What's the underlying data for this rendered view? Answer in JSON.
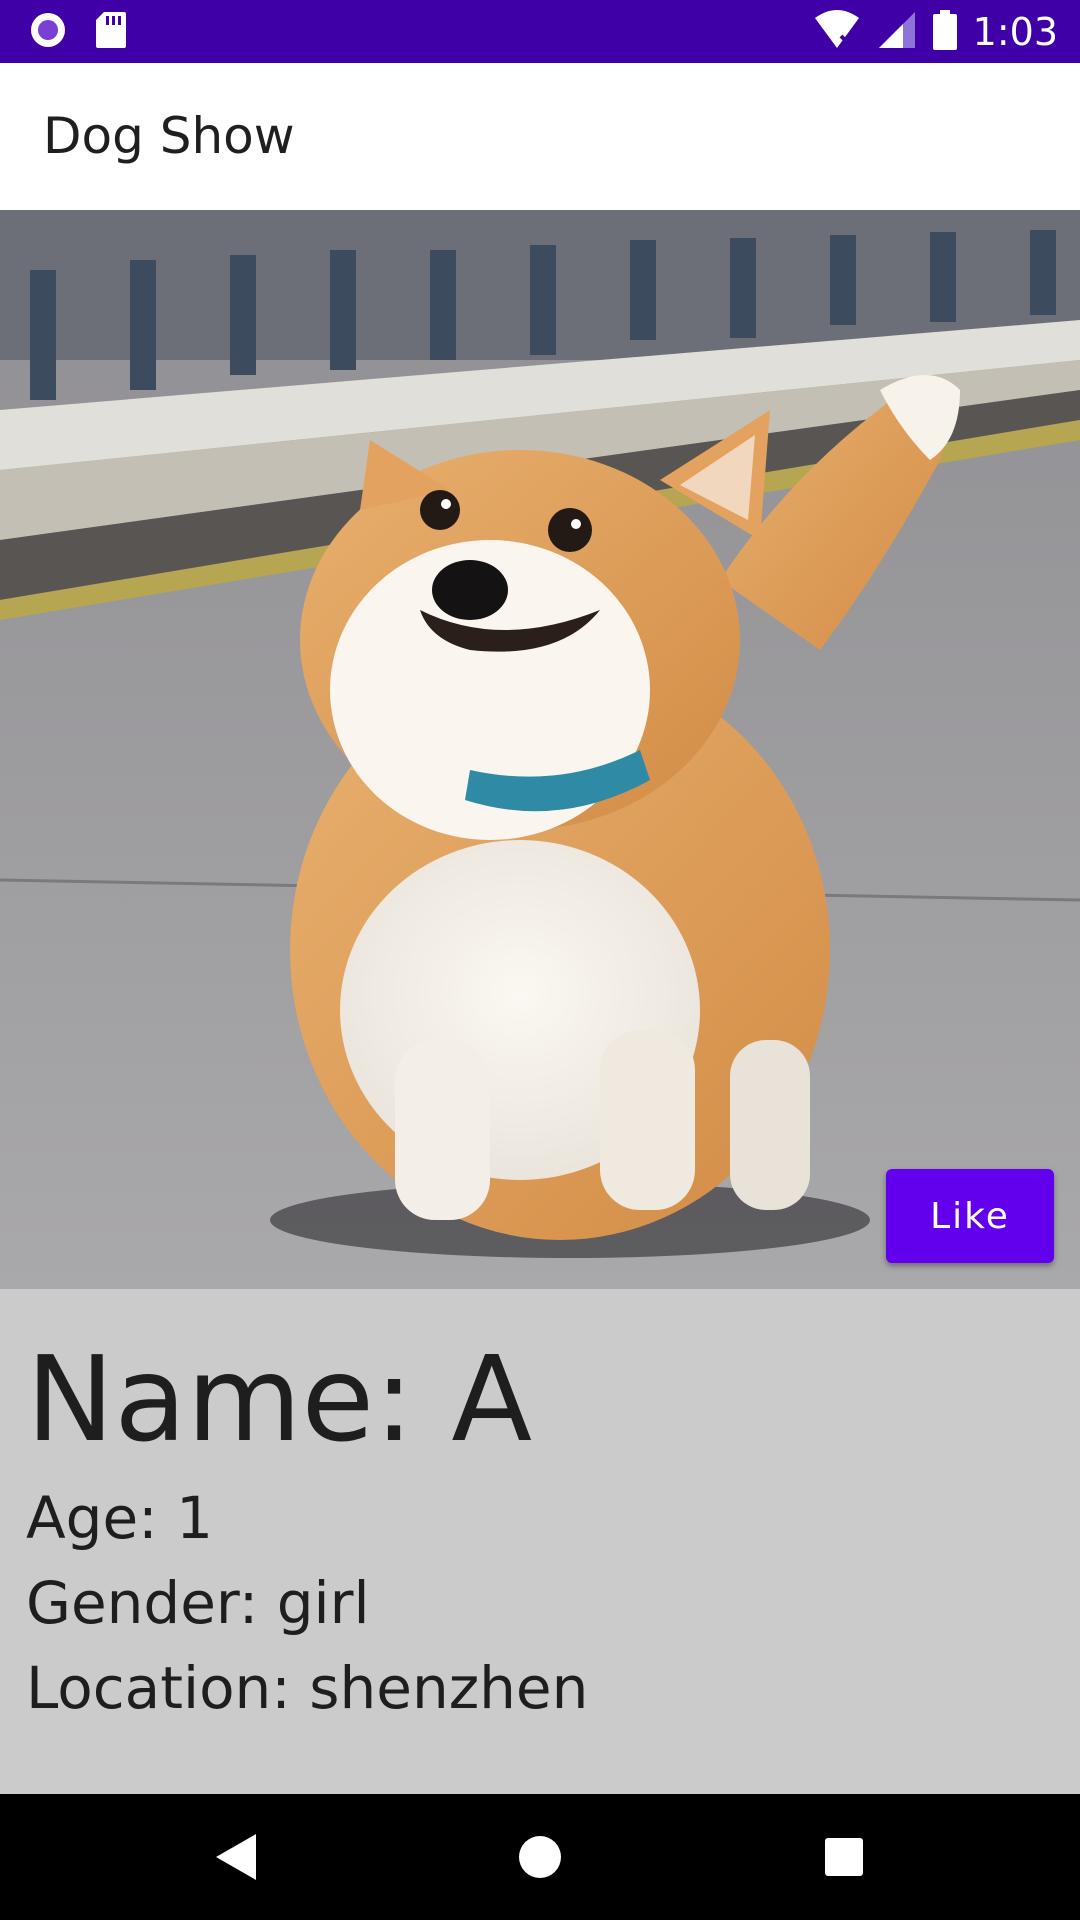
{
  "status_bar": {
    "time": "1:03",
    "background": "#3f00a7",
    "icons": [
      "record-icon",
      "sd-card-icon",
      "wifi-off-icon",
      "signal-icon",
      "battery-icon"
    ]
  },
  "app_bar": {
    "title": "Dog Show"
  },
  "dog": {
    "photo_subject": "corgi-photo",
    "like_label": "Like",
    "name": "Name: A",
    "age": "Age: 1",
    "gender": "Gender: girl",
    "location": "Location: shenzhen"
  },
  "colors": {
    "accent": "#6200ee",
    "info_background": "#cbcbcb",
    "nav_background": "#000000"
  },
  "nav_bar": {
    "icons": [
      "back-icon",
      "home-icon",
      "recents-icon"
    ]
  }
}
